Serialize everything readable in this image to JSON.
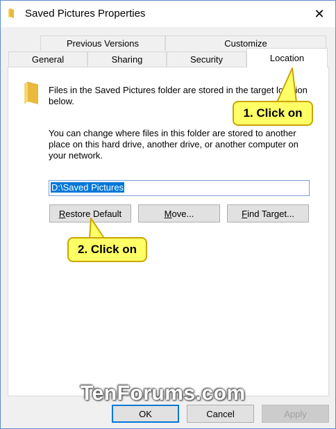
{
  "window": {
    "title": "Saved Pictures Properties"
  },
  "tabs": {
    "previous_versions": "Previous Versions",
    "customize": "Customize",
    "general": "General",
    "sharing": "Sharing",
    "security": "Security",
    "location": "Location"
  },
  "location": {
    "description1": "Files in the Saved Pictures folder are stored in the target location below.",
    "description2": "You can change where files in this folder are stored to another place on this hard drive, another drive, or another computer on your network.",
    "path_value": "D:\\Saved Pictures"
  },
  "buttons": {
    "restore_default_u": "R",
    "restore_default_rest": "estore Default",
    "move_u": "M",
    "move_rest": "ove...",
    "find_target_u": "F",
    "find_target_rest": "ind Target...",
    "ok": "OK",
    "cancel": "Cancel",
    "apply_u": "A",
    "apply_rest": "pply"
  },
  "callouts": {
    "step1": "1. Click on",
    "step2": "2. Click on"
  },
  "watermark": "TenForums.com",
  "colors": {
    "accent": "#0078d7",
    "callout_fill": "#ffff66",
    "callout_border": "#c8a400"
  }
}
